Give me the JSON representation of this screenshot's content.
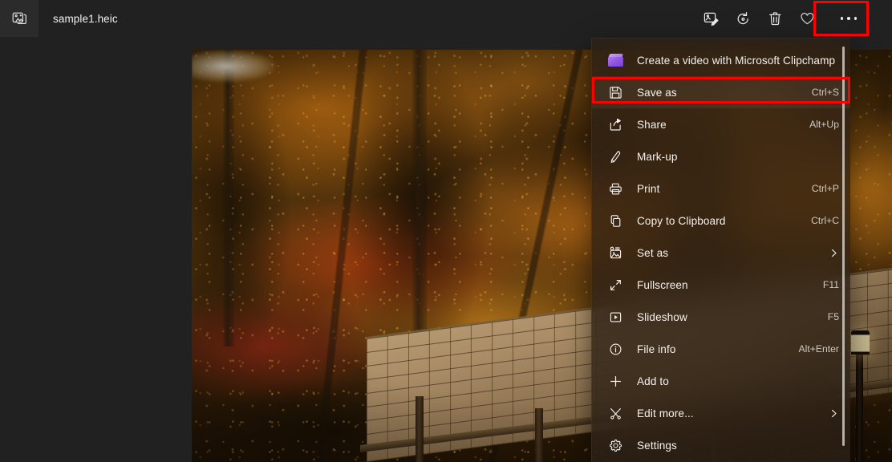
{
  "app": {
    "icon": "photos-app-icon",
    "filename": "sample1.heic",
    "background_color": "#212121"
  },
  "toolbar": {
    "buttons": [
      {
        "name": "edit-image",
        "icon": "edit-image-icon",
        "label": "Edit image"
      },
      {
        "name": "rotate",
        "icon": "rotate-icon",
        "label": "Rotate"
      },
      {
        "name": "delete",
        "icon": "trash-icon",
        "label": "Delete"
      },
      {
        "name": "favorite",
        "icon": "heart-icon",
        "label": "Add to favorites"
      },
      {
        "name": "see-more",
        "icon": "ellipsis-icon",
        "label": "See more"
      }
    ],
    "highlighted_button": "see-more"
  },
  "menu": {
    "highlighted_item": "Save as",
    "hovered_item": "Save as",
    "scrollbar_visible": true,
    "items": [
      {
        "label": "Create a video with Microsoft Clipchamp",
        "accel": "",
        "icon": "clipchamp-icon",
        "submenu": false
      },
      {
        "label": "Save as",
        "accel": "Ctrl+S",
        "icon": "save-icon",
        "submenu": false
      },
      {
        "label": "Share",
        "accel": "Alt+Up",
        "icon": "share-icon",
        "submenu": false
      },
      {
        "label": "Mark-up",
        "accel": "",
        "icon": "pen-icon",
        "submenu": false
      },
      {
        "label": "Print",
        "accel": "Ctrl+P",
        "icon": "print-icon",
        "submenu": false
      },
      {
        "label": "Copy to Clipboard",
        "accel": "Ctrl+C",
        "icon": "copy-icon",
        "submenu": false
      },
      {
        "label": "Set as",
        "accel": "",
        "icon": "set-as-icon",
        "submenu": true
      },
      {
        "label": "Fullscreen",
        "accel": "F11",
        "icon": "fullscreen-icon",
        "submenu": false
      },
      {
        "label": "Slideshow",
        "accel": "F5",
        "icon": "slideshow-icon",
        "submenu": false
      },
      {
        "label": "File info",
        "accel": "Alt+Enter",
        "icon": "info-icon",
        "submenu": false
      },
      {
        "label": "Add to",
        "accel": "",
        "icon": "plus-icon",
        "submenu": false
      },
      {
        "label": "Edit more...",
        "accel": "",
        "icon": "edit-more-icon",
        "submenu": true
      },
      {
        "label": "Settings",
        "accel": "",
        "icon": "gear-icon",
        "submenu": false
      }
    ]
  },
  "photo": {
    "description": "Autumn forest with wooden shingle roof",
    "alt": "sample1.heic"
  },
  "highlight_color": "#fe0000"
}
